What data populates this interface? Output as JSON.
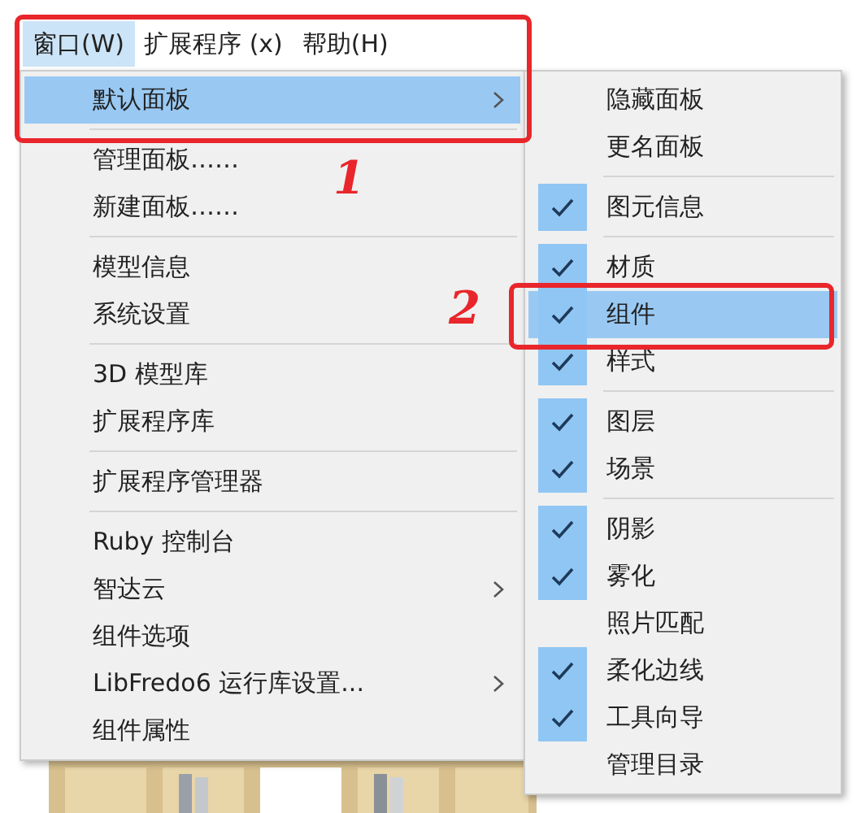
{
  "menu_bar": [
    {
      "label": "窗口(W)",
      "selected": true
    },
    {
      "label": "扩展程序 (x)",
      "selected": false
    },
    {
      "label": "帮助(H)",
      "selected": false
    }
  ],
  "menu": [
    {
      "kind": "item",
      "label": "默认面板",
      "selected": true,
      "submenu": true
    },
    {
      "kind": "separator"
    },
    {
      "kind": "item",
      "label": "管理面板……",
      "selected": false,
      "submenu": false
    },
    {
      "kind": "item",
      "label": "新建面板……",
      "selected": false,
      "submenu": false
    },
    {
      "kind": "separator"
    },
    {
      "kind": "item",
      "label": "模型信息",
      "selected": false,
      "submenu": false
    },
    {
      "kind": "item",
      "label": "系统设置",
      "selected": false,
      "submenu": false
    },
    {
      "kind": "separator"
    },
    {
      "kind": "item",
      "label": "3D 模型库",
      "selected": false,
      "submenu": false
    },
    {
      "kind": "item",
      "label": "扩展程序库",
      "selected": false,
      "submenu": false
    },
    {
      "kind": "separator"
    },
    {
      "kind": "item",
      "label": "扩展程序管理器",
      "selected": false,
      "submenu": false
    },
    {
      "kind": "separator"
    },
    {
      "kind": "item",
      "label": "Ruby 控制台",
      "selected": false,
      "submenu": false
    },
    {
      "kind": "item",
      "label": "智达云",
      "selected": false,
      "submenu": true
    },
    {
      "kind": "item",
      "label": "组件选项",
      "selected": false,
      "submenu": false
    },
    {
      "kind": "item",
      "label": "LibFredo6 运行库设置...",
      "selected": false,
      "submenu": true
    },
    {
      "kind": "item",
      "label": "组件属性",
      "selected": false,
      "submenu": false
    }
  ],
  "submenu": [
    {
      "kind": "item",
      "label": "隐藏面板",
      "checked": false,
      "selected": false
    },
    {
      "kind": "item",
      "label": "更名面板",
      "checked": false,
      "selected": false
    },
    {
      "kind": "separator"
    },
    {
      "kind": "item",
      "label": "图元信息",
      "checked": true,
      "selected": false
    },
    {
      "kind": "separator"
    },
    {
      "kind": "item",
      "label": "材质",
      "checked": true,
      "selected": false
    },
    {
      "kind": "item",
      "label": "组件",
      "checked": true,
      "selected": true
    },
    {
      "kind": "item",
      "label": "样式",
      "checked": true,
      "selected": false
    },
    {
      "kind": "separator"
    },
    {
      "kind": "item",
      "label": "图层",
      "checked": true,
      "selected": false
    },
    {
      "kind": "item",
      "label": "场景",
      "checked": true,
      "selected": false
    },
    {
      "kind": "separator"
    },
    {
      "kind": "item",
      "label": "阴影",
      "checked": true,
      "selected": false
    },
    {
      "kind": "item",
      "label": "雾化",
      "checked": true,
      "selected": false
    },
    {
      "kind": "item",
      "label": "照片匹配",
      "checked": false,
      "selected": false
    },
    {
      "kind": "item",
      "label": "柔化边线",
      "checked": true,
      "selected": false
    },
    {
      "kind": "item",
      "label": "工具向导",
      "checked": true,
      "selected": false
    },
    {
      "kind": "item",
      "label": "管理目录",
      "checked": false,
      "selected": false
    }
  ],
  "annotations": [
    {
      "label": "1"
    },
    {
      "label": "2"
    }
  ]
}
